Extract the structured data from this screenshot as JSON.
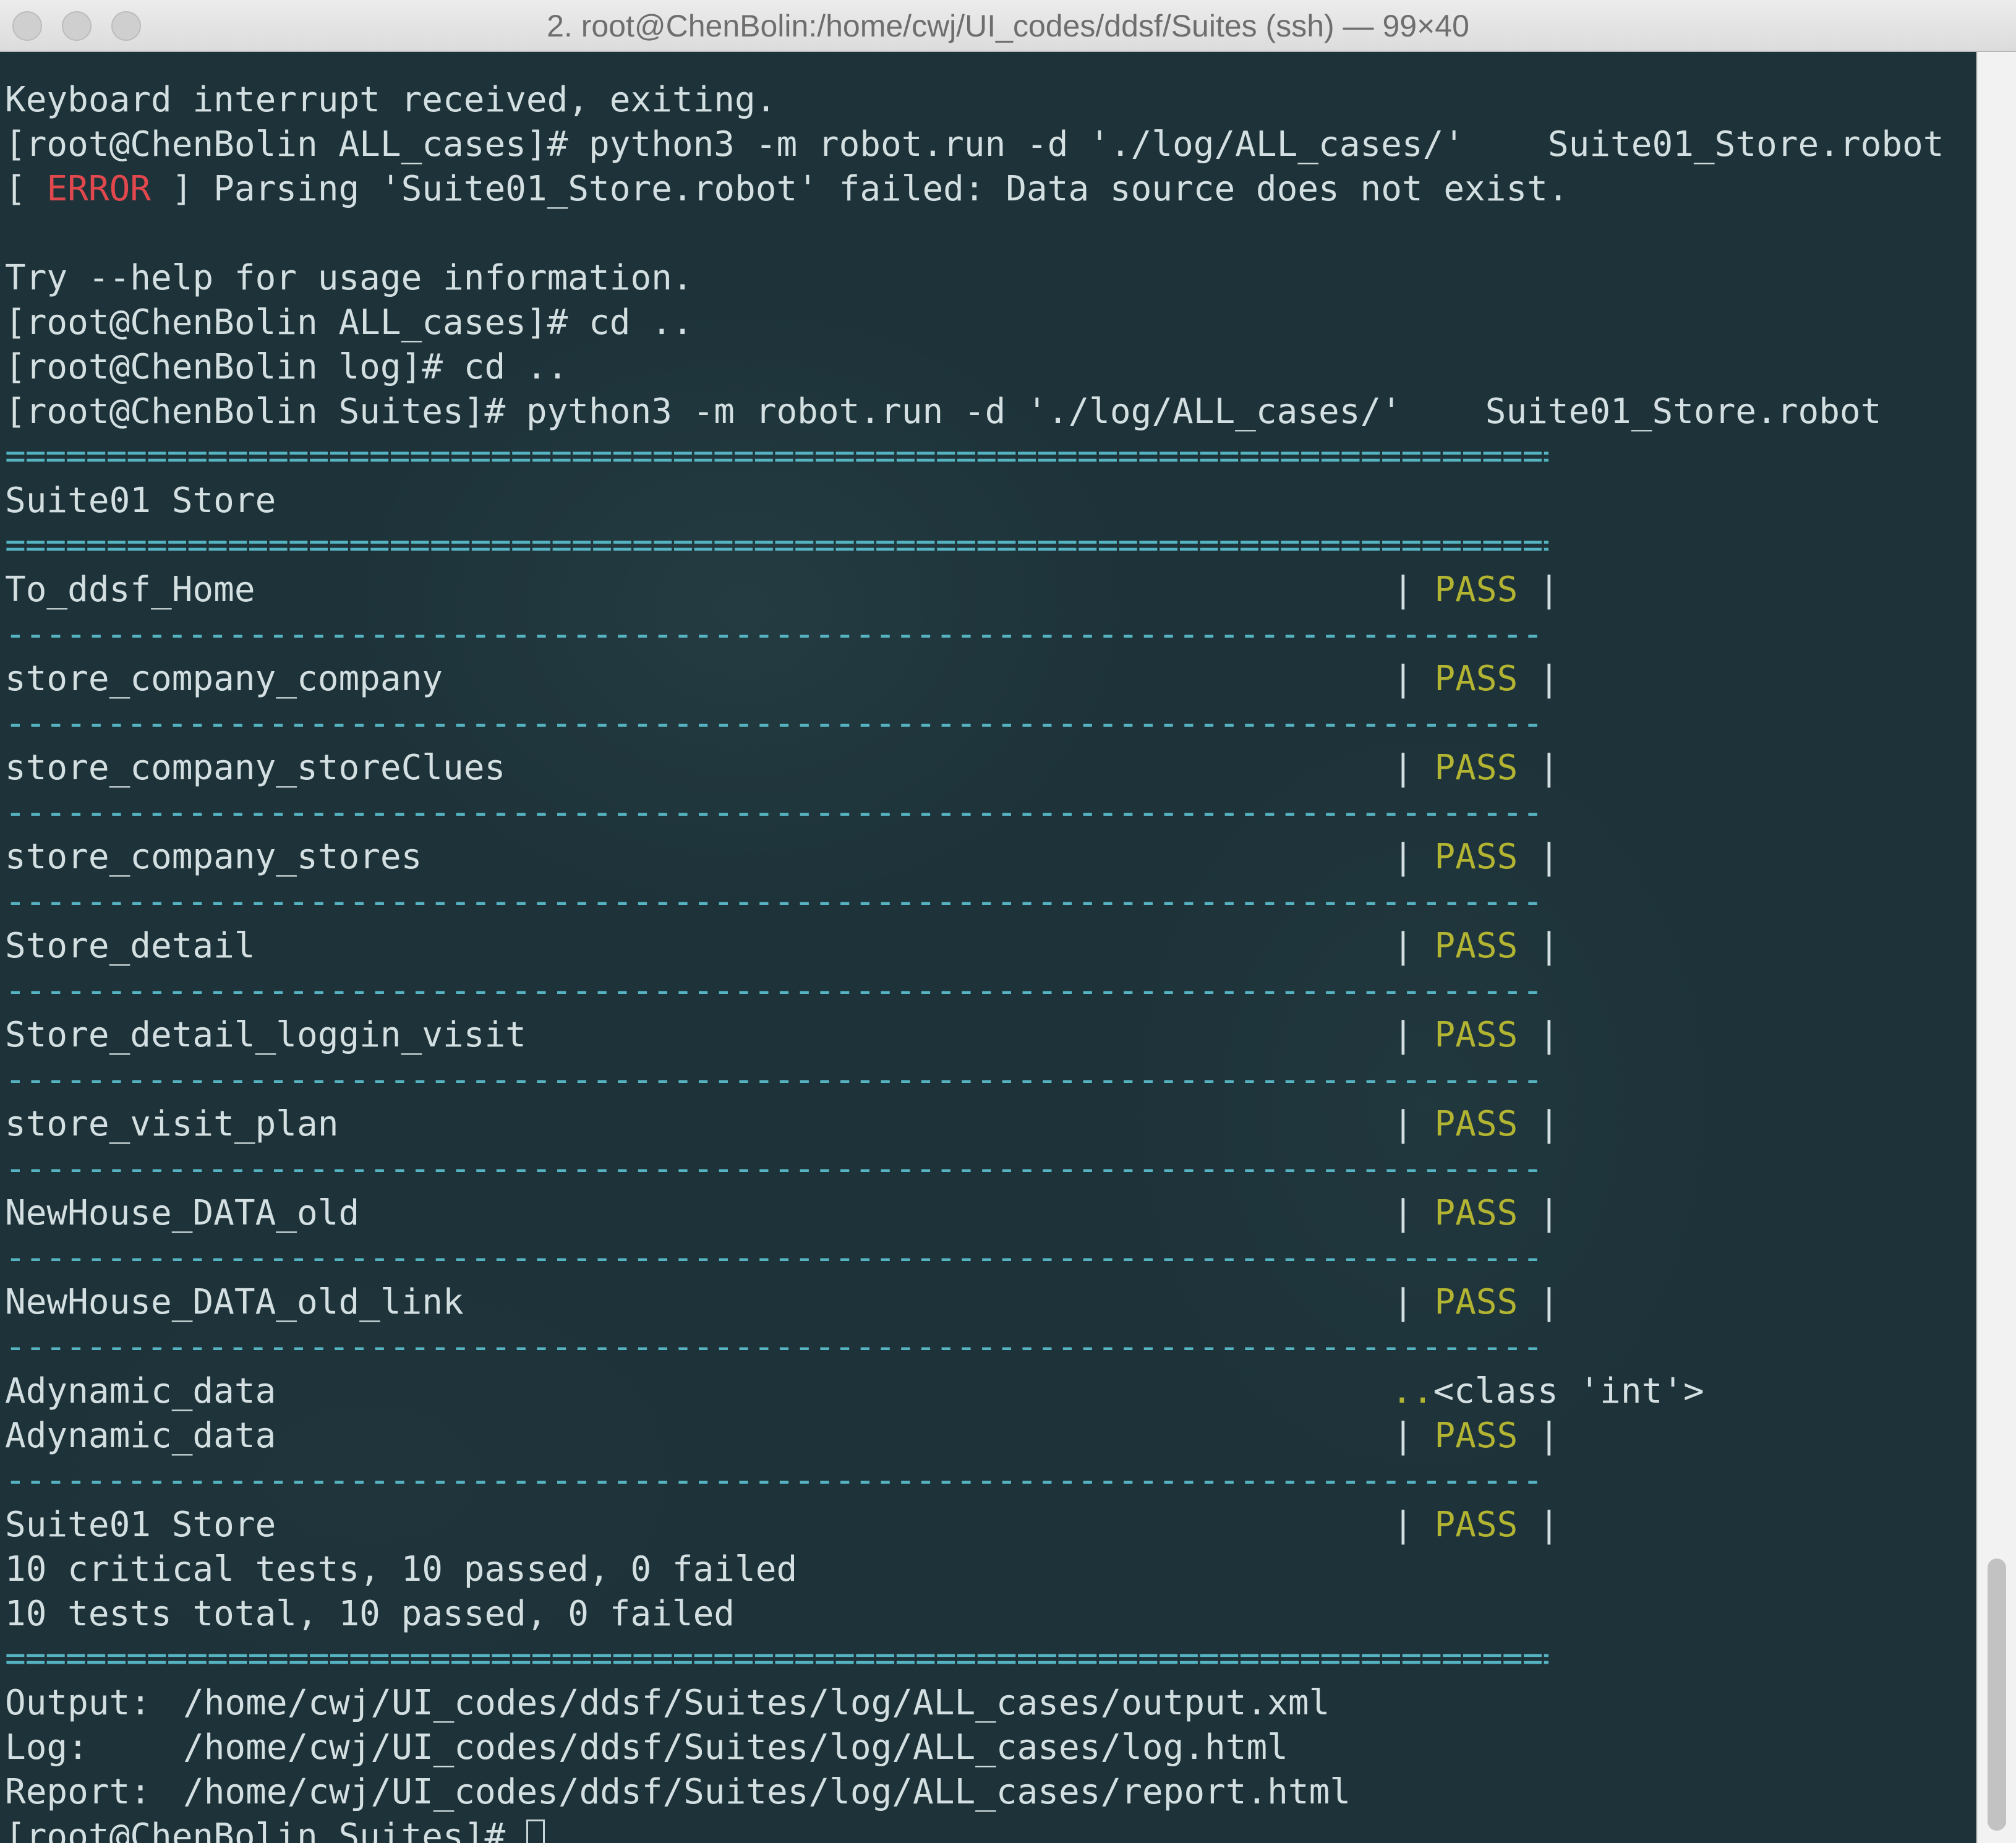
{
  "window": {
    "title": "2. root@ChenBolin:/home/cwj/UI_codes/ddsf/Suites (ssh) — 99×40"
  },
  "terminal": {
    "line_keyboard": "Keyboard interrupt received, exiting.",
    "line_cmd1": "[root@ChenBolin ALL_cases]# python3 -m robot.run -d './log/ALL_cases/'    Suite01_Store.robot",
    "error_open": "[ ",
    "error_tag": "ERROR",
    "error_rest": " ] Parsing 'Suite01_Store.robot' failed: Data source does not exist.",
    "line_help": "Try --help for usage information.",
    "line_cd1": "[root@ChenBolin ALL_cases]# cd ..",
    "line_cd2": "[root@ChenBolin log]# cd ..",
    "line_cmd2": "[root@ChenBolin Suites]# python3 -m robot.run -d './log/ALL_cases/'    Suite01_Store.robot",
    "sep_eq": "==============================================================================",
    "sep_dash": "------------------------------------------------------------------------------",
    "suite_header": "Suite01 Store",
    "pipe": "|",
    "tests": [
      {
        "name": "To_ddsf_Home",
        "status": "PASS"
      },
      {
        "name": "store_company_company",
        "status": "PASS"
      },
      {
        "name": "store_company_storeClues",
        "status": "PASS"
      },
      {
        "name": "store_company_stores",
        "status": "PASS"
      },
      {
        "name": "Store_detail",
        "status": "PASS"
      },
      {
        "name": "Store_detail_loggin_visit",
        "status": "PASS"
      },
      {
        "name": "store_visit_plan",
        "status": "PASS"
      },
      {
        "name": "NewHouse_DATA_old",
        "status": "PASS"
      },
      {
        "name": "NewHouse_DATA_old_link",
        "status": "PASS"
      },
      {
        "name": "Adynamic_data",
        "status": "PASS"
      }
    ],
    "adynamic_progress_name": "Adynamic_data",
    "adynamic_dots": "..",
    "adynamic_output": "<class 'int'>",
    "suite_result_name": "Suite01 Store",
    "suite_result_status": "PASS",
    "critical_summary": "10 critical tests, 10 passed, 0 failed",
    "total_summary": "10 tests total, 10 passed, 0 failed",
    "output_label": "Output:",
    "output_path": "/home/cwj/UI_codes/ddsf/Suites/log/ALL_cases/output.xml",
    "log_label": "Log:",
    "log_path": "/home/cwj/UI_codes/ddsf/Suites/log/ALL_cases/log.html",
    "report_label": "Report:",
    "report_path": "/home/cwj/UI_codes/ddsf/Suites/log/ALL_cases/report.html",
    "prompt": "[root@ChenBolin Suites]# "
  },
  "colors": {
    "background": "#1d3339",
    "foreground": "#d3dfe1",
    "error": "#e0484e",
    "pass": "#b3b431",
    "separator": "#56b4c2"
  }
}
